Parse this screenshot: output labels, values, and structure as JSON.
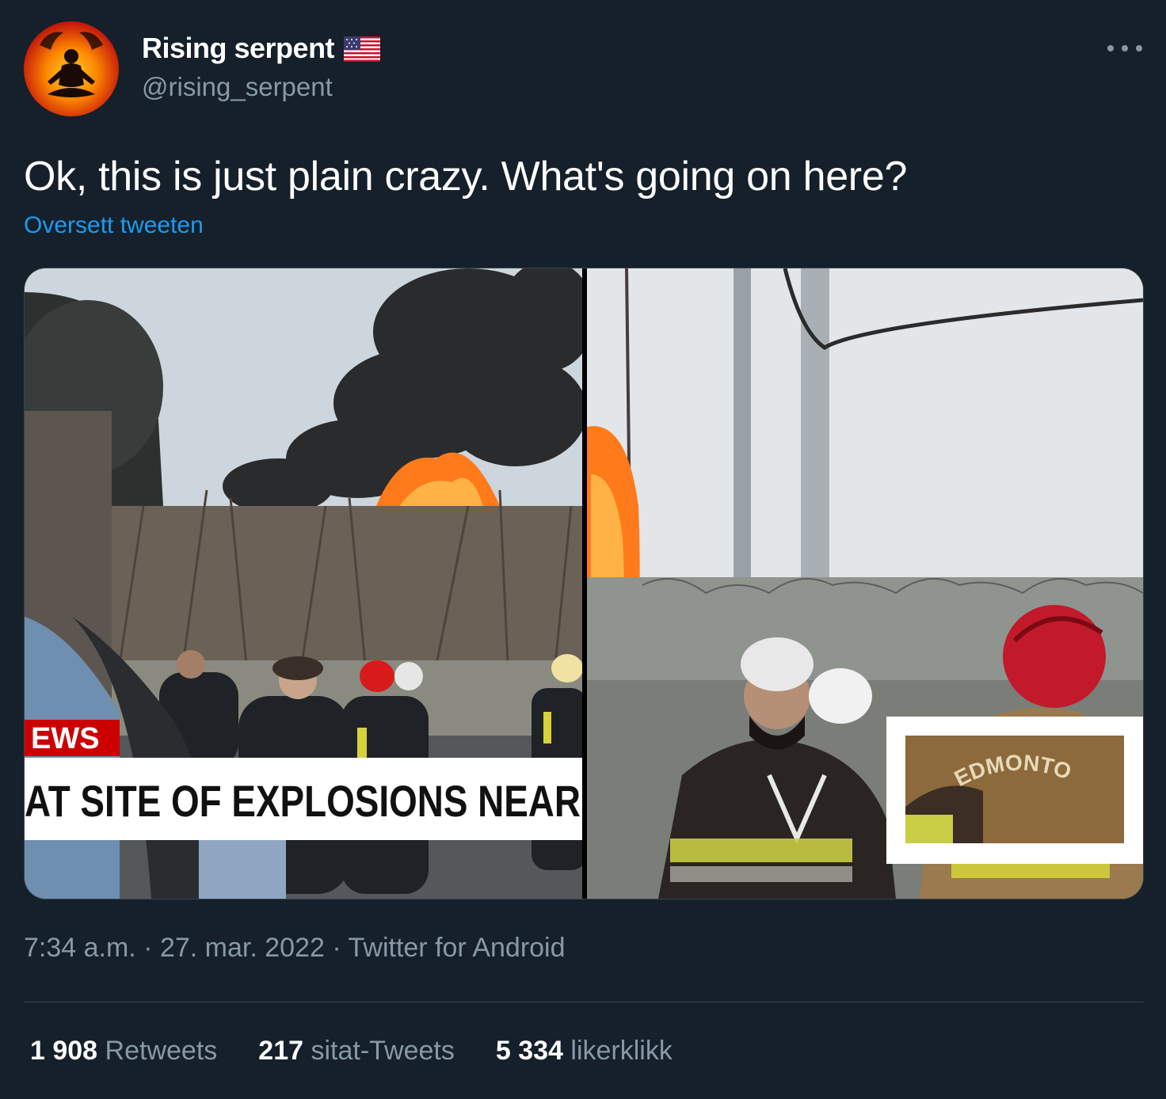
{
  "author": {
    "display_name": "Rising serpent",
    "handle": "@rising_serpent",
    "flag_icon": "us-flag-icon",
    "avatar_icon": "meditating-figure-avatar"
  },
  "tweet": {
    "text": "Ok, this is just plain crazy. What's going on here?",
    "translate_label": "Oversett tweeten"
  },
  "media": {
    "left_caption_tag": "EWS",
    "left_caption_headline": "AT SITE OF EXPLOSIONS NEAR",
    "right_zoom_text": "EDMONTO"
  },
  "meta": {
    "time": "7:34 a.m.",
    "sep1": " · ",
    "date": "27. mar. 2022",
    "sep2": " · ",
    "source": "Twitter for Android"
  },
  "stats": {
    "retweets_count": "1 908",
    "retweets_label": "Retweets",
    "quotes_count": "217",
    "quotes_label": "sitat-Tweets",
    "likes_count": "5 334",
    "likes_label": "likerklikk"
  },
  "colors": {
    "background": "#15202b",
    "muted": "#8899a6",
    "link": "#1d9bf0",
    "divider": "#38444d"
  }
}
